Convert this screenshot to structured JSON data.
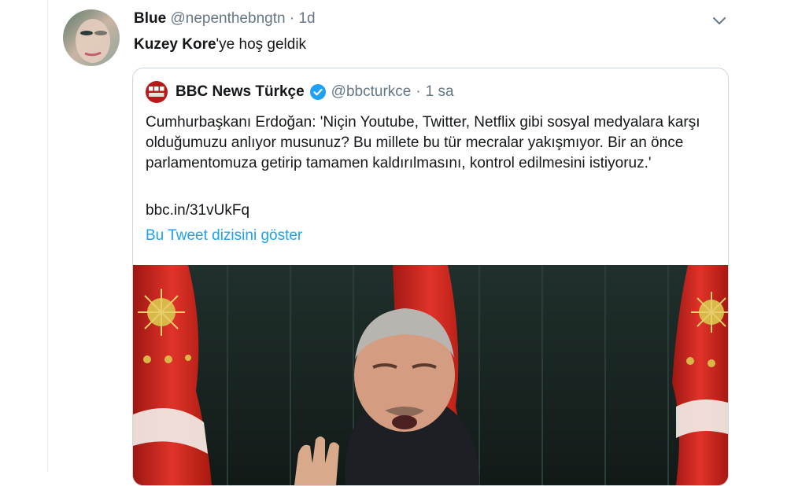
{
  "tweet": {
    "author_name": "Blue",
    "author_handle": "@nepenthebngtn",
    "separator": "·",
    "time": "1d",
    "text_bold": "Kuzey Kore",
    "text_rest": "'ye hoş geldik"
  },
  "quoted": {
    "author_name": "BBC News Türkçe",
    "author_handle": "@bbcturkce",
    "separator": "·",
    "time": "1 sa",
    "text": "Cumhurbaşkanı Erdoğan: 'Niçin Youtube, Twitter, Netflix gibi sosyal medyalara karşı olduğumuzu anlıyor musunuz? Bu millete bu tür mecralar yakışmıyor. Bir an önce parlamentomuza getirip tamamen kaldırılmasını, kontrol edilmesini istiyoruz.'",
    "link": "bbc.in/31vUkFq",
    "show_thread": "Bu Tweet dizisini göster",
    "logo_text": "BBC\nNEWS"
  },
  "icons": {
    "menu": "chevron-down-icon",
    "verified": "verified-badge-icon"
  },
  "colors": {
    "link": "#1da1f2",
    "verified": "#1da1f2",
    "bbc_red": "#bb1919",
    "flag_red": "#d8281f"
  }
}
